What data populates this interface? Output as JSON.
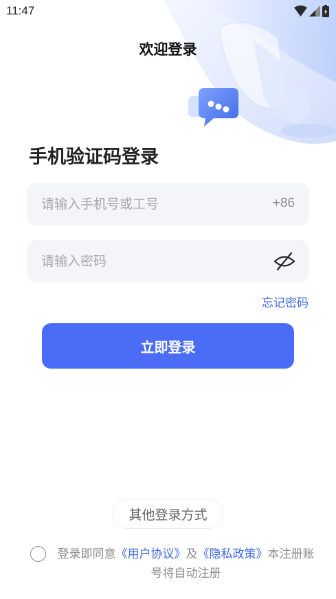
{
  "status_bar": {
    "time": "11:47",
    "icons": [
      "wifi-icon",
      "signal-icon",
      "battery-icon"
    ]
  },
  "header": {
    "title": "欢迎登录"
  },
  "form": {
    "heading": "手机验证码登录",
    "phone": {
      "placeholder": "请输入手机号或工号",
      "value": "",
      "country_code": "+86"
    },
    "password": {
      "placeholder": "请输入密码",
      "value": "",
      "toggle_icon": "eye-off-icon"
    },
    "forgot_label": "忘记密码",
    "submit_label": "立即登录"
  },
  "footer": {
    "other_login_label": "其他登录方式",
    "agreement": {
      "checked": false,
      "prefix": "登录即同意",
      "user_agreement": "《用户协议》",
      "conjunction": "及",
      "privacy_policy": "《隐私政策》",
      "suffix": "本注册账号将自动注册"
    }
  },
  "colors": {
    "primary": "#4a6cf7",
    "link": "#3f6ae6",
    "field_bg": "#f4f5f9",
    "placeholder": "#a6a8ae"
  }
}
